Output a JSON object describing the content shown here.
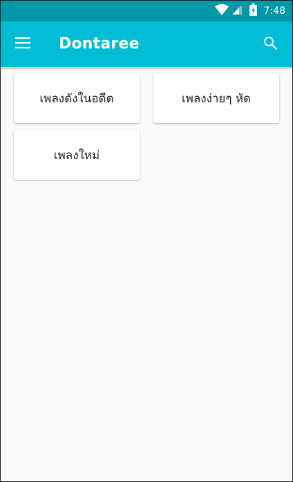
{
  "status_bar": {
    "time": "7:48",
    "icons": [
      "wifi-icon",
      "cell-signal-icon",
      "battery-charging-icon"
    ],
    "color": "#0097a7"
  },
  "app_bar": {
    "title": "Dontaree",
    "menu_icon": "hamburger-menu-icon",
    "search_icon": "search-icon",
    "color": "#00bcd4"
  },
  "categories": [
    {
      "label": "เพลงดังในอดีต"
    },
    {
      "label": "เพลงง่ายๆ หัด"
    },
    {
      "label": "เพลงใหม่"
    }
  ]
}
